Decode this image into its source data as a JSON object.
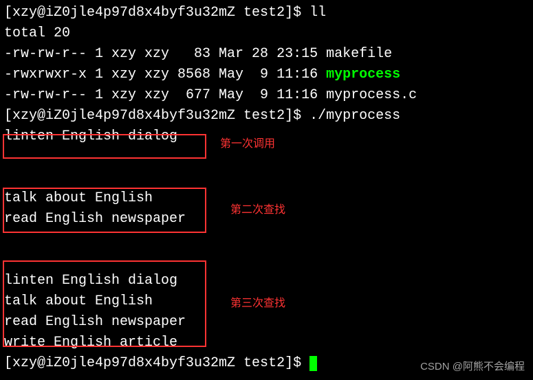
{
  "prompt1": "[xzy@iZ0jle4p97d8x4byf3u32mZ test2]$ ",
  "cmd1": "ll",
  "total": "total 20",
  "file1": "-rw-rw-r-- 1 xzy xzy   83 Mar 28 23:15 makefile",
  "file2_prefix": "-rwxrwxr-x 1 xzy xzy 8568 May  9 11:16 ",
  "file2_name": "myprocess",
  "file3": "-rw-rw-r-- 1 xzy xzy  677 May  9 11:16 myprocess.c",
  "prompt2": "[xzy@iZ0jle4p97d8x4byf3u32mZ test2]$ ",
  "cmd2": "./myprocess",
  "out_block1": {
    "l1": "linten English dialog"
  },
  "blank": " ",
  "out_block2": {
    "l1": "talk about English",
    "l2": "read English newspaper"
  },
  "out_block3": {
    "l1": "linten English dialog",
    "l2": "talk about English",
    "l3": "read English newspaper",
    "l4": "write English article"
  },
  "prompt3": "[xzy@iZ0jle4p97d8x4byf3u32mZ test2]$ ",
  "labels": {
    "a": "第一次调用",
    "b": "第二次查找",
    "c": "第三次查找"
  },
  "watermark": "CSDN @阿熊不会编程"
}
